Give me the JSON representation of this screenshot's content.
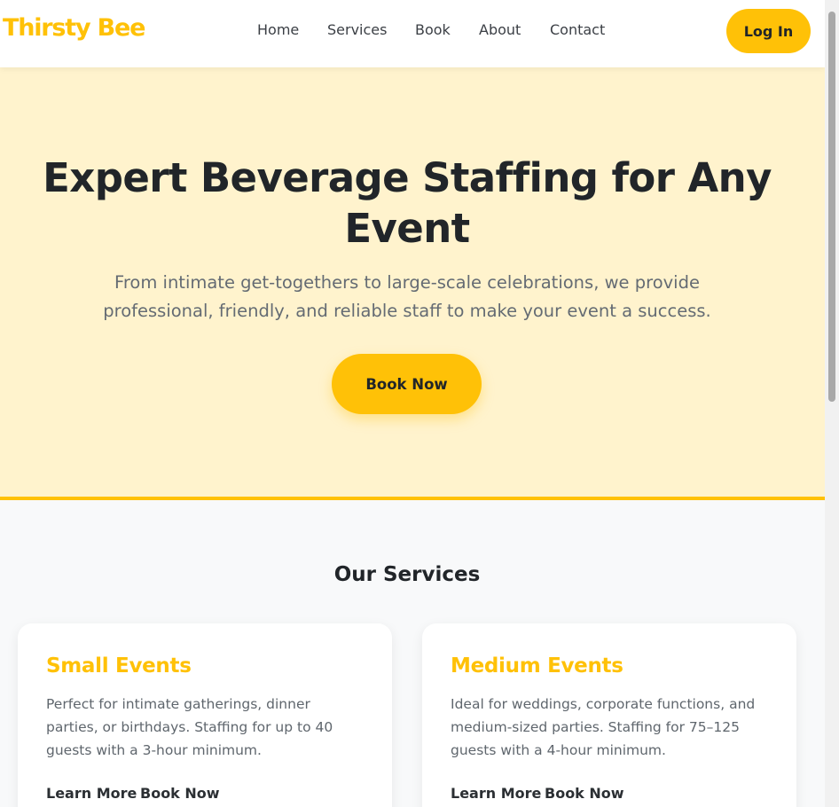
{
  "brand": {
    "logo_text": "Thirsty Bee",
    "accent_color": "#ffc107",
    "hero_bg": "#fff3cd"
  },
  "nav": {
    "items": [
      {
        "label": "Home"
      },
      {
        "label": "Services"
      },
      {
        "label": "Book"
      },
      {
        "label": "About"
      },
      {
        "label": "Contact"
      }
    ],
    "login_label": "Log In"
  },
  "hero": {
    "title": "Expert Beverage Staffing for Any Event",
    "subtitle": "From intimate get-togethers to large-scale celebrations, we provide professional, friendly, and reliable staff to make your event a success.",
    "cta_label": "Book Now"
  },
  "services": {
    "heading": "Our Services",
    "cards": [
      {
        "title": "Small Events",
        "description": "Perfect for intimate gatherings, dinner parties, or birthdays. Staffing for up to 40 guests with a 3-hour minimum.",
        "learn_more": "Learn More",
        "book_now": "Book Now"
      },
      {
        "title": "Medium Events",
        "description": "Ideal for weddings, corporate functions, and medium-sized parties. Staffing for 75–125 guests with a 4-hour minimum.",
        "learn_more": "Learn More",
        "book_now": "Book Now"
      }
    ]
  }
}
